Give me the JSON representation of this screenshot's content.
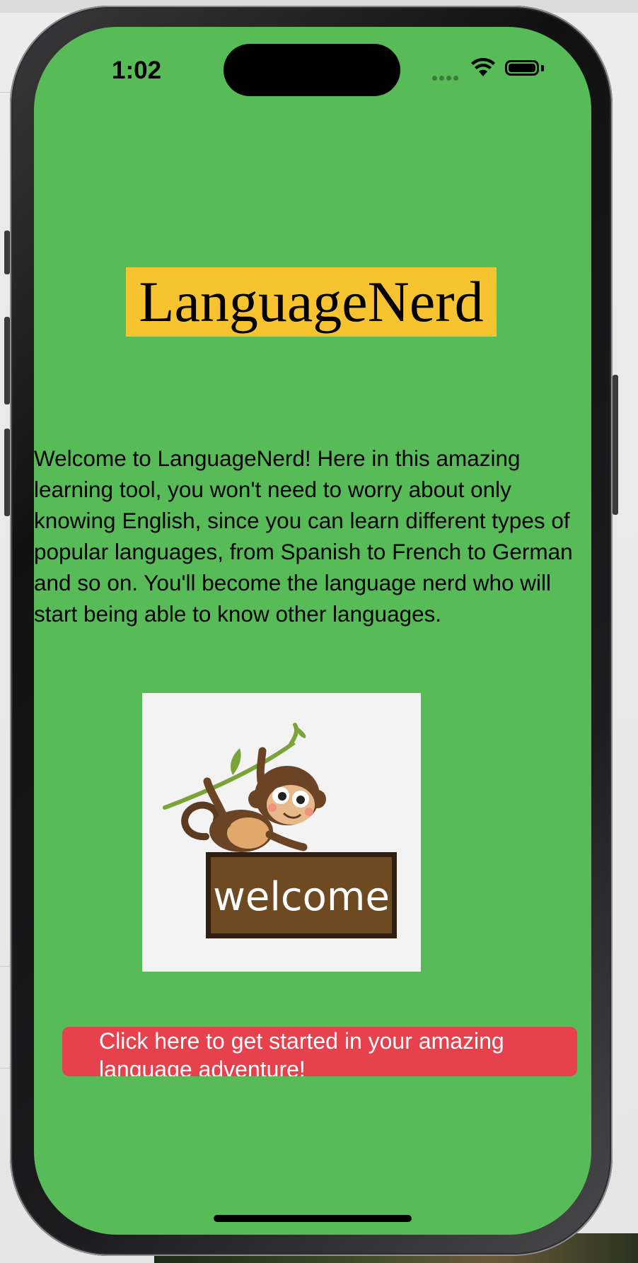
{
  "status_bar": {
    "time": "1:02"
  },
  "app": {
    "title": "LanguageNerd",
    "intro": "Welcome to LanguageNerd! Here in this amazing learning tool, you won't need to worry about only knowing English, since you can learn different types of popular languages, from Spanish to French to German and so on. You'll become the language nerd who will start being able to know other languages.",
    "image": {
      "sign_text": "welcome"
    },
    "cta_button": "Click here to get started in your amazing language adventure!"
  },
  "colors": {
    "screen_background": "#57bb57",
    "title_highlight": "#f7c430",
    "button_background": "#e8414e",
    "sign_wood": "#6e4a22"
  },
  "icons": [
    "signal-icon",
    "wifi-icon",
    "battery-icon"
  ]
}
